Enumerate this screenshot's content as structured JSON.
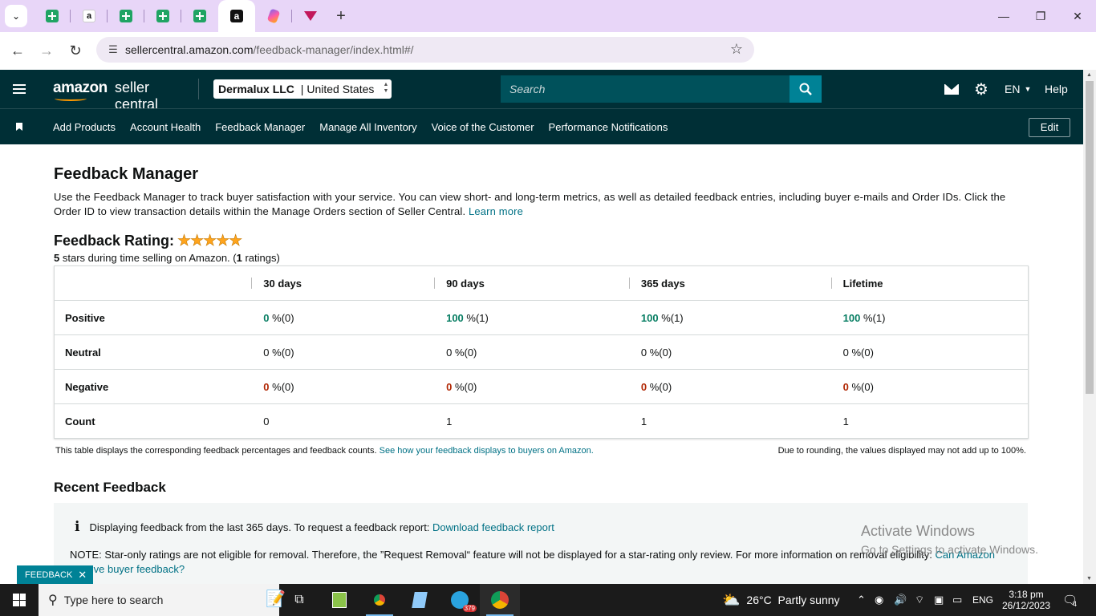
{
  "browser": {
    "tabs": [
      {
        "icon": "sheets-icon"
      },
      {
        "icon": "amazon-icon"
      },
      {
        "icon": "sheets-icon"
      },
      {
        "icon": "sheets-icon"
      },
      {
        "icon": "sheets-icon"
      },
      {
        "icon": "amazon-dark-icon",
        "active": true
      },
      {
        "icon": "clickup-icon"
      },
      {
        "icon": "triangle-icon"
      }
    ],
    "url_host": "sellercentral.amazon.com",
    "url_path": "/feedback-manager/index.html#/"
  },
  "header": {
    "logo_a": "amazon",
    "logo_b": "seller central",
    "account_name": "Dermalux LLC",
    "account_sep": " | ",
    "account_region": "United States",
    "search_placeholder": "Search",
    "language": "EN",
    "help": "Help"
  },
  "nav": {
    "items": [
      "Add Products",
      "Account Health",
      "Feedback Manager",
      "Manage All Inventory",
      "Voice of the Customer",
      "Performance Notifications"
    ],
    "edit": "Edit"
  },
  "page": {
    "title": "Feedback Manager",
    "intro": "Use the Feedback Manager to track buyer satisfaction with your service. You can view short- and long-term metrics, as well as detailed feedback entries, including buyer e-mails and Order IDs. Click the Order ID to view transaction details within the Manage Orders section of Seller Central.",
    "learn_more": "Learn more",
    "rating_title": "Feedback Rating:",
    "stars": "★★★★★",
    "rating_value": "5",
    "rating_mid": " stars during time selling on Amazon. (",
    "rating_count": "1",
    "rating_end": " ratings)"
  },
  "table": {
    "headers": [
      "30 days",
      "90 days",
      "365 days",
      "Lifetime"
    ],
    "rows": [
      {
        "label": "Positive",
        "kind": "g",
        "cells": [
          {
            "v": "0",
            "s": " %(0)"
          },
          {
            "v": "100",
            "s": " %(1)"
          },
          {
            "v": "100",
            "s": " %(1)"
          },
          {
            "v": "100",
            "s": " %(1)"
          }
        ]
      },
      {
        "label": "Neutral",
        "kind": "n",
        "cells": [
          {
            "v": "0",
            "s": " %(0)"
          },
          {
            "v": "0",
            "s": " %(0)"
          },
          {
            "v": "0",
            "s": " %(0)"
          },
          {
            "v": "0",
            "s": " %(0)"
          }
        ]
      },
      {
        "label": "Negative",
        "kind": "r",
        "cells": [
          {
            "v": "0",
            "s": " %(0)"
          },
          {
            "v": "0",
            "s": " %(0)"
          },
          {
            "v": "0",
            "s": " %(0)"
          },
          {
            "v": "0",
            "s": " %(0)"
          }
        ]
      },
      {
        "label": "Count",
        "kind": "n",
        "cells": [
          {
            "v": "0",
            "s": ""
          },
          {
            "v": "1",
            "s": ""
          },
          {
            "v": "1",
            "s": ""
          },
          {
            "v": "1",
            "s": ""
          }
        ]
      }
    ],
    "note_left": "This table displays the corresponding feedback percentages and feedback counts.",
    "note_link": "See how your feedback displays to buyers on Amazon.",
    "note_right": "Due to rounding, the values displayed may not add up to 100%."
  },
  "recent": {
    "title": "Recent Feedback",
    "info_text": "Displaying feedback from the last 365 days. To request a feedback report:",
    "info_link": "Download feedback report",
    "note_text": "NOTE: Star-only ratings are not eligible for removal. Therefore, the ”Request Removal“ feature will not be displayed for a star-rating only review. For more information on removal eligibility:",
    "note_link": "Can Amazon remove buyer feedback?"
  },
  "feedback_tag": "FEEDBACK",
  "watermark": {
    "line1": "Activate Windows",
    "line2": "Go to Settings to activate Windows."
  },
  "taskbar": {
    "search_placeholder": "Type here to search",
    "weather": "26°C  Partly sunny",
    "lang": "ENG",
    "time": "3:18 pm",
    "date": "26/12/2023",
    "telegram_badge": "379",
    "notif_count": "4"
  },
  "colors": {
    "amazon_header": "#002f36",
    "positive": "#067d62",
    "negative": "#b12704",
    "link": "#007185"
  }
}
